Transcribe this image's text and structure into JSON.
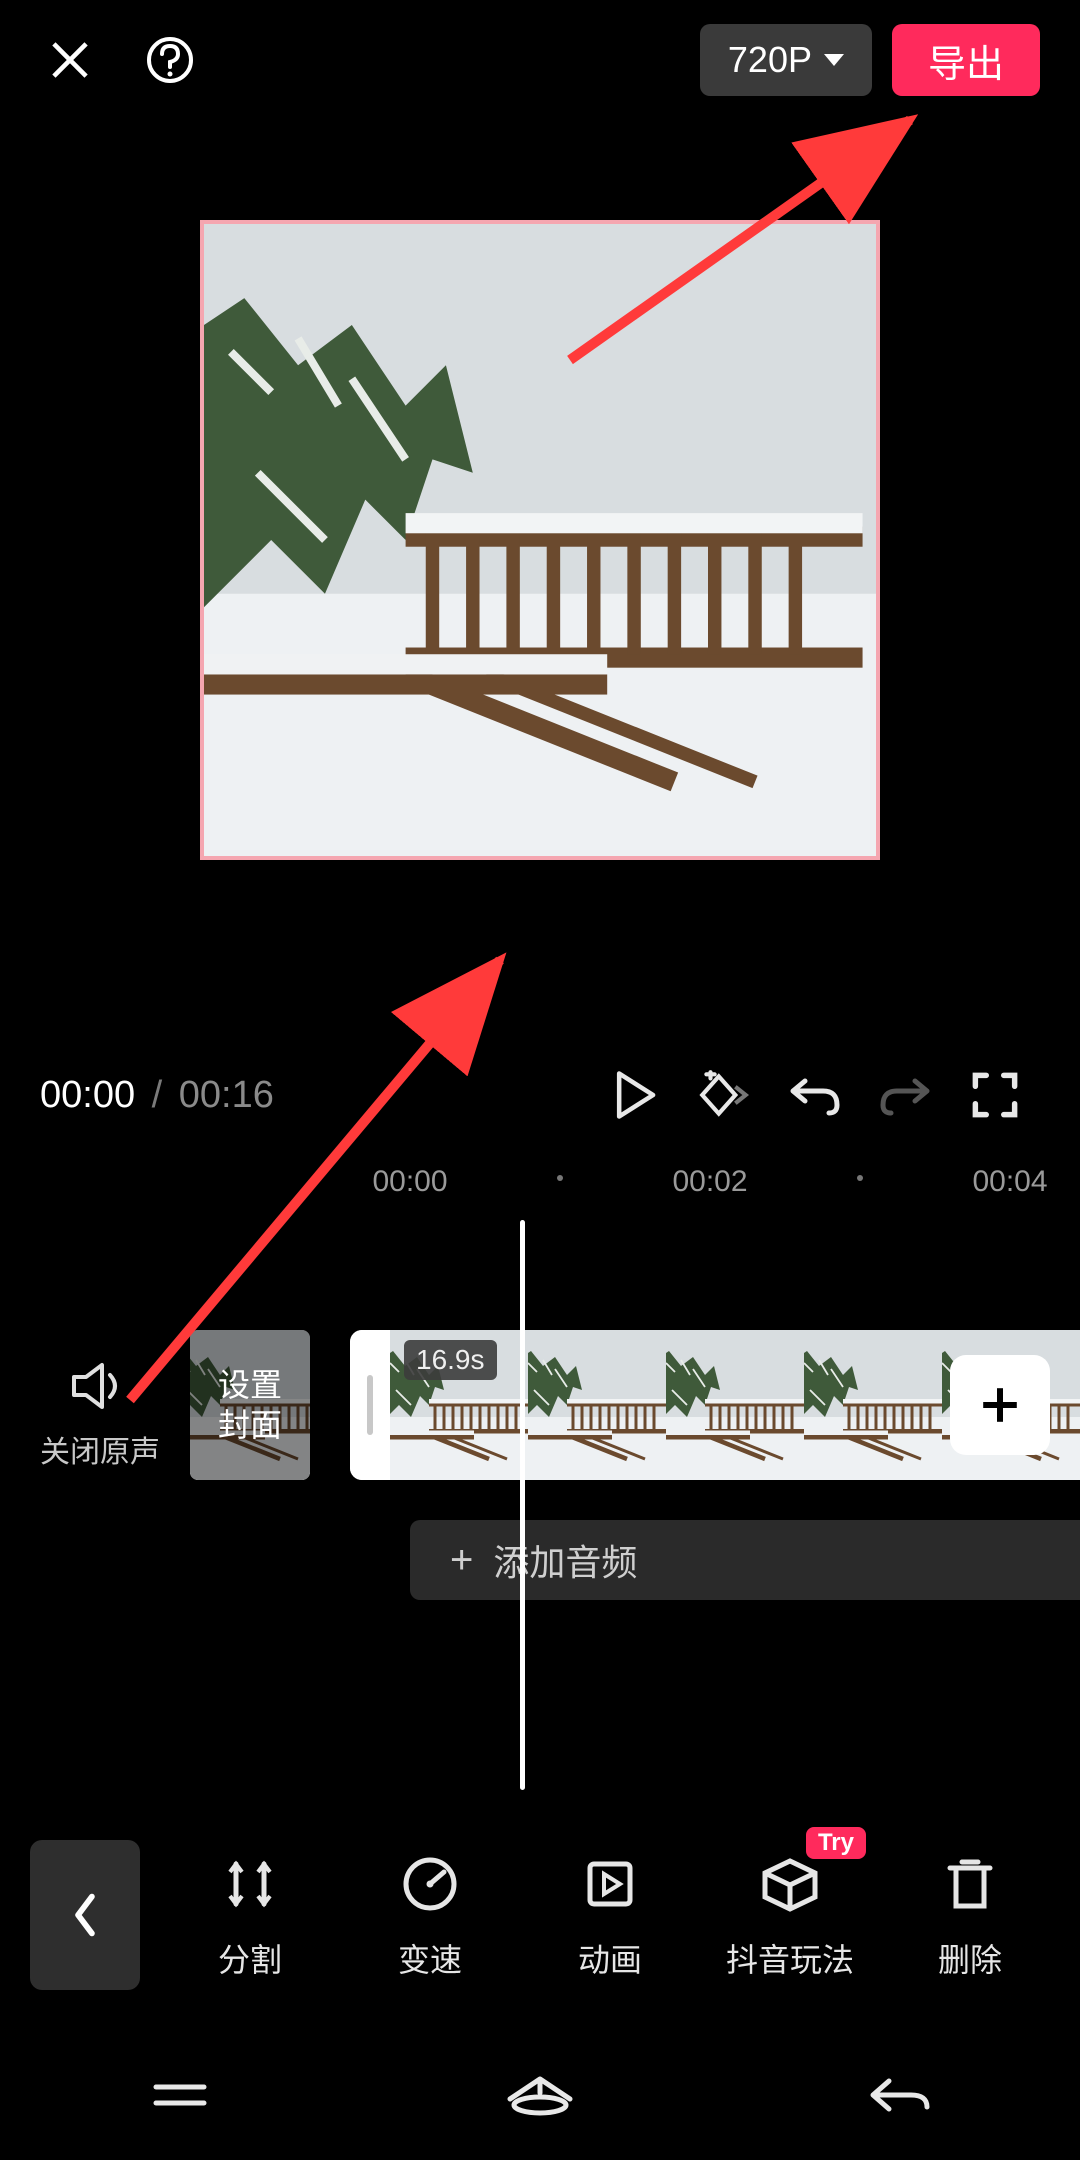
{
  "header": {
    "resolution_label": "720P",
    "export_label": "导出"
  },
  "playback": {
    "current_time": "00:00",
    "separator": "/",
    "total_time": "00:16"
  },
  "ruler": {
    "marks": [
      "00:00",
      "00:02",
      "00:04"
    ]
  },
  "mute": {
    "label": "关闭原声"
  },
  "cover": {
    "line1": "设置",
    "line2": "封面"
  },
  "clip": {
    "duration_badge": "16.9s"
  },
  "audio": {
    "add_label": "添加音频"
  },
  "tools": {
    "split": "分割",
    "speed": "变速",
    "animation": "动画",
    "douyin": "抖音玩法",
    "delete": "删除",
    "try_badge": "Try"
  }
}
